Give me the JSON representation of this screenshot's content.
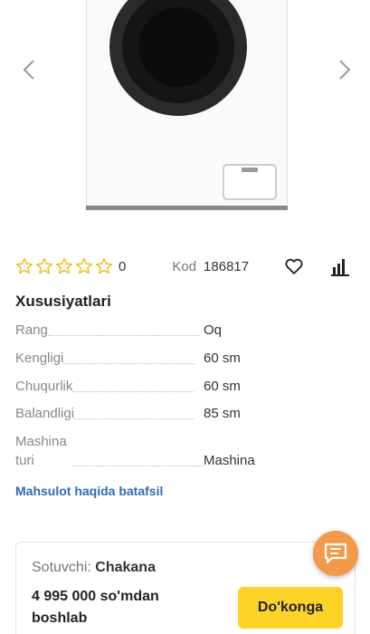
{
  "gallery": {
    "prev_icon": "chevron-left-icon",
    "next_icon": "chevron-right-icon",
    "image_subject": "washing-machine"
  },
  "product": {
    "rating_value": 0,
    "rating_max": 5,
    "rating_count": "0",
    "code_label": "Kod",
    "code_value": "186817",
    "favorite_icon": "heart-icon",
    "compare_icon": "compare-icon"
  },
  "specs": {
    "title": "Xususiyatlari",
    "rows": [
      {
        "label": "Rang",
        "value": "Oq"
      },
      {
        "label": "Kengligi",
        "value": "60 sm"
      },
      {
        "label": "Chuqurlik",
        "value": "60 sm"
      },
      {
        "label": "Balandligi",
        "value": "85 sm"
      },
      {
        "label_line1": "Mashina",
        "label_line2": "turi",
        "value": "Mashina"
      }
    ],
    "more_link": "Mahsulot haqida batafsil"
  },
  "seller": {
    "label": "Sotuvchi:",
    "name": "Chakana",
    "price_line1": "4 995 000 so'mdan",
    "price_line2": "boshlab",
    "button_label": "Do'konga"
  },
  "chat": {
    "icon": "chat-icon",
    "color": "#f2994a"
  },
  "colors": {
    "accent_button": "#fdd32a",
    "link": "#2f6cb3",
    "star_outline": "#f0b800"
  }
}
